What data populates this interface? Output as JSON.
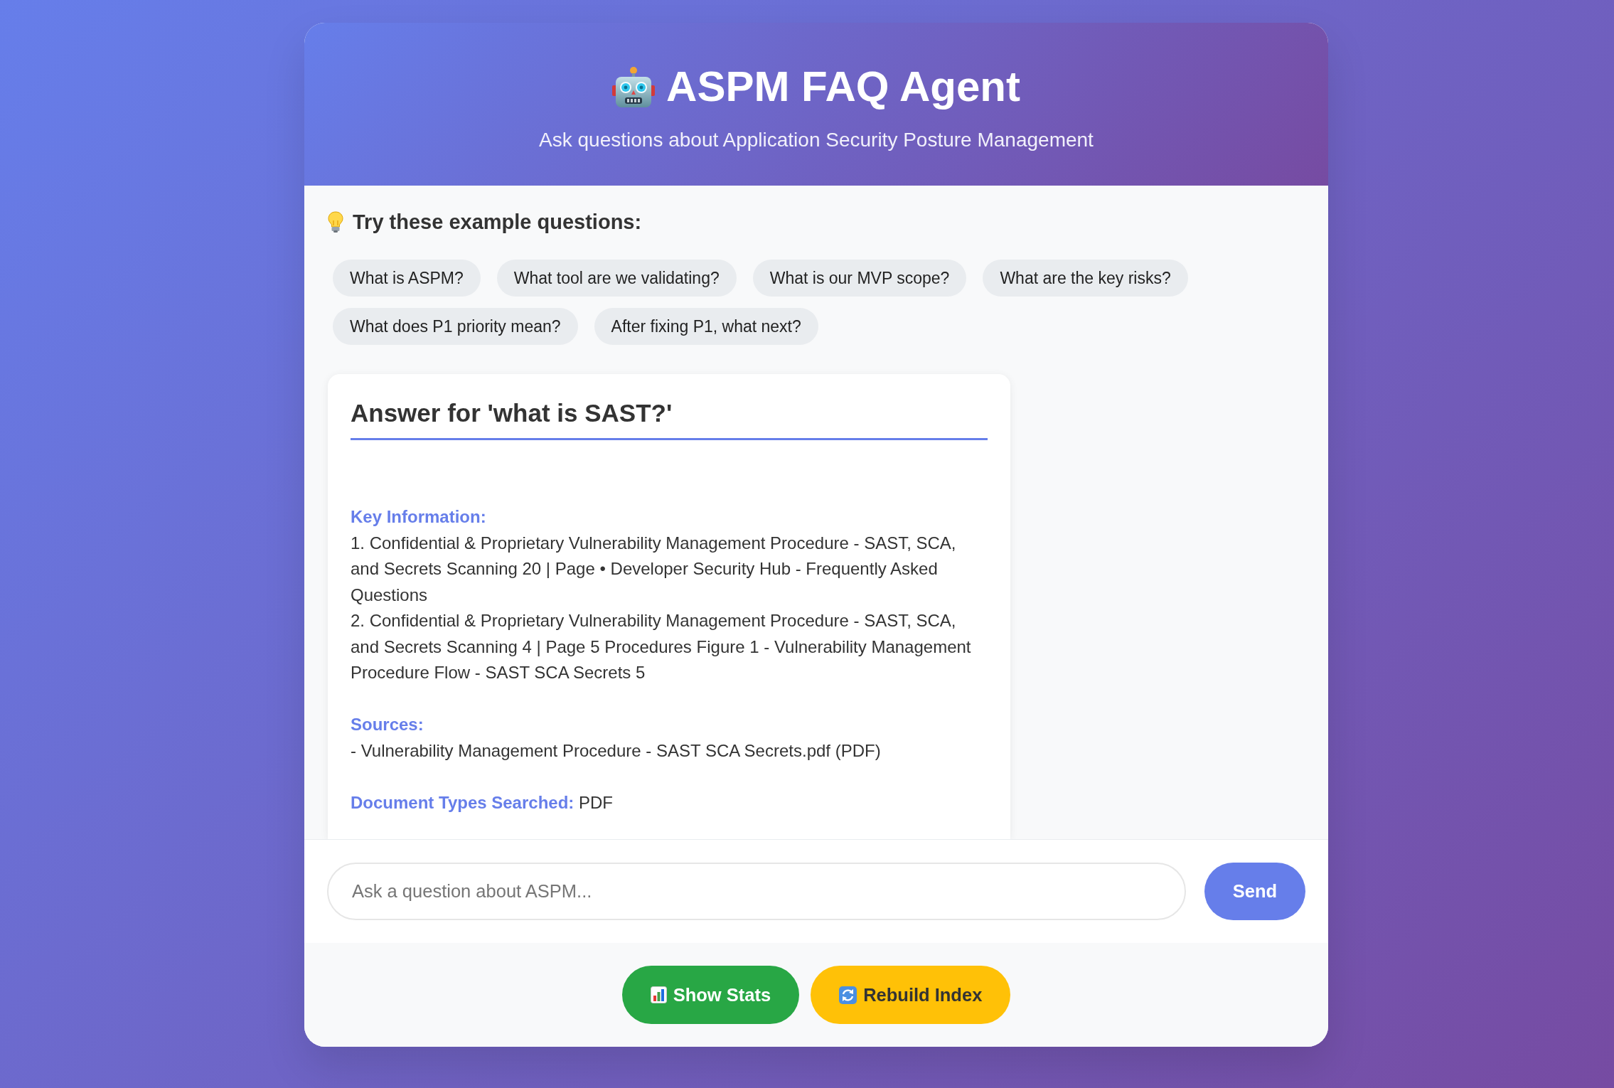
{
  "header": {
    "title": "ASPM FAQ Agent",
    "subtitle": "Ask questions about Application Security Posture Management"
  },
  "examples": {
    "heading": "Try these example questions:",
    "questions": [
      "What is ASPM?",
      "What tool are we validating?",
      "What is our MVP scope?",
      "What are the key risks?",
      "What does P1 priority mean?",
      "After fixing P1, what next?"
    ]
  },
  "answer": {
    "title": "Answer for 'what is SAST?'",
    "sections": [
      {
        "kind": "list",
        "label": "Key Information:",
        "lines": [
          "1. Confidential & Proprietary Vulnerability Management Procedure - SAST, SCA, and Secrets Scanning 20 | Page • Developer Security Hub - Frequently Asked Questions",
          "2. Confidential & Proprietary Vulnerability Management Procedure - SAST, SCA, and Secrets Scanning 4 | Page 5 Procedures Figure 1 - Vulnerability Management Procedure Flow - SAST SCA Secrets 5"
        ]
      },
      {
        "kind": "list",
        "label": "Sources:",
        "lines": [
          "- Vulnerability Management Procedure - SAST SCA Secrets.pdf (PDF)"
        ]
      },
      {
        "kind": "inline",
        "label": "Document Types Searched:",
        "value": "PDF"
      }
    ]
  },
  "composer": {
    "placeholder": "Ask a question about ASPM...",
    "send_label": "Send"
  },
  "actions": [
    {
      "kind": "stats",
      "label": "Show Stats"
    },
    {
      "kind": "rebuild",
      "label": "Rebuild Index"
    }
  ]
}
